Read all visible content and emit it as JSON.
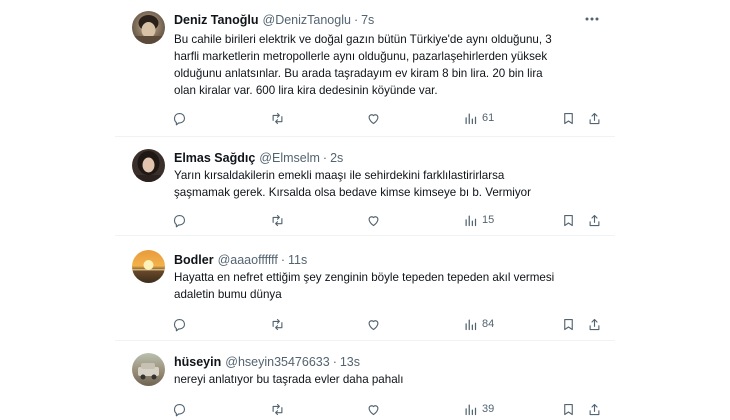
{
  "tweets": [
    {
      "name": "Deniz Tanoğlu",
      "handle": "@DenizTanoglu",
      "time": "7s",
      "lines": [
        "Bu cahile birileri elektrik ve doğal gazın bütün Türkiye'de aynı olduğunu, 3",
        "harfli marketlerin metropollerle aynı olduğunu, pazarlaşehirlerden yüksek",
        "olduğunu anlatsınlar. Bu arada taşradayım ev kiram 8 bin lira. 20 bin lira",
        "olan kiralar var. 600 lira kira dedesinin köyünde var."
      ],
      "views": "61"
    },
    {
      "name": "Elmas Sağdıç",
      "handle": "@Elmselm",
      "time": "2s",
      "lines": [
        "Yarın kırsaldakilerin emekli maaşı ile sehirdekini farklılastirirlarsa",
        "şaşmamak gerek.  Kırsalda olsa bedave kimse kimseye bı b.  Vermiyor"
      ],
      "views": "15"
    },
    {
      "name": "Bodler",
      "handle": "@aaaoffffff",
      "time": "11s",
      "lines": [
        "Hayatta en nefret ettiğim şey zenginin böyle tepeden tepeden akıl vermesi",
        "adaletin bumu dünya"
      ],
      "views": "84"
    },
    {
      "name": "hüseyin",
      "handle": "@hseyin35476633",
      "time": "13s",
      "lines": [
        "nereyi anlatıyor bu taşrada evler daha pahalı"
      ],
      "views": "39"
    }
  ],
  "separator": "·",
  "icons": {
    "reply": "reply-icon",
    "retweet": "retweet-icon",
    "like": "like-icon",
    "views": "views-icon",
    "bookmark": "bookmark-icon",
    "share": "share-icon",
    "more": "more-icon"
  },
  "colors": {
    "text": "#0f1419",
    "secondary": "#536471",
    "divider": "#eff3f4"
  }
}
